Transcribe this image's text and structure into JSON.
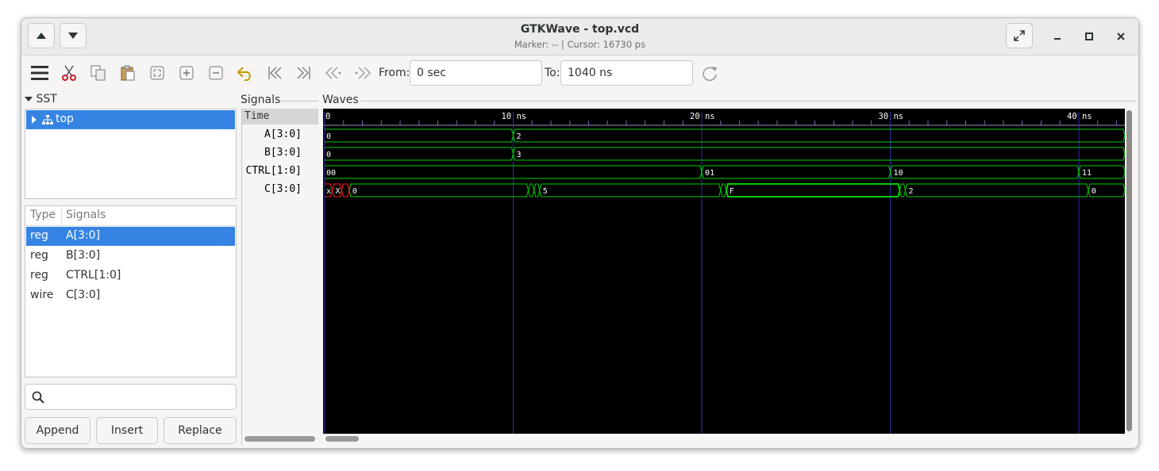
{
  "window": {
    "title": "GTKWave - top.vcd",
    "subtitle": "Marker: --  |  Cursor: 16730 ps"
  },
  "toolbar": {
    "icons": [
      "menu-icon",
      "cut-icon",
      "copy-icon",
      "paste-icon",
      "zoom-fit-icon",
      "zoom-in-icon",
      "zoom-out-icon",
      "undo-icon",
      "go-start-icon",
      "go-end-icon",
      "prev-edge-icon",
      "next-edge-icon",
      "reload-icon"
    ],
    "from_label": "From:",
    "from_value": "0 sec",
    "to_label": "To:",
    "to_value": "1040 ns"
  },
  "sst": {
    "header": "SST",
    "tree_item": "top"
  },
  "signal_list": {
    "col_type": "Type",
    "col_signals": "Signals",
    "rows": [
      {
        "type": "reg",
        "name": "A[3:0]"
      },
      {
        "type": "reg",
        "name": "B[3:0]"
      },
      {
        "type": "reg",
        "name": "CTRL[1:0]"
      },
      {
        "type": "wire",
        "name": "C[3:0]"
      }
    ],
    "search_placeholder": ""
  },
  "buttons": {
    "append": "Append",
    "insert": "Insert",
    "replace": "Replace"
  },
  "signals_pane": {
    "header": "Signals",
    "time_label": "Time",
    "names": [
      "A[3:0]",
      "B[3:0]",
      "CTRL[1:0]",
      "C[3:0]"
    ]
  },
  "waves_pane": {
    "header": "Waves",
    "ticks": [
      {
        "t": 0,
        "label": "0"
      },
      {
        "t": 10,
        "label": "10 ns"
      },
      {
        "t": 20,
        "label": "20 ns"
      },
      {
        "t": 30,
        "label": "30 ns"
      },
      {
        "t": 40,
        "label": "40 ns"
      }
    ],
    "view_end_ns": 42.5,
    "traces": [
      {
        "name": "A[3:0]",
        "segments": [
          {
            "t0": 0,
            "t1": 10,
            "v": "0"
          },
          {
            "t0": 10,
            "t1": 42.5,
            "v": "2"
          }
        ]
      },
      {
        "name": "B[3:0]",
        "segments": [
          {
            "t0": 0,
            "t1": 10,
            "v": "0"
          },
          {
            "t0": 10,
            "t1": 42.5,
            "v": "3"
          }
        ]
      },
      {
        "name": "CTRL[1:0]",
        "segments": [
          {
            "t0": 0,
            "t1": 20,
            "v": "00"
          },
          {
            "t0": 20,
            "t1": 30,
            "v": "01"
          },
          {
            "t0": 30,
            "t1": 40,
            "v": "10"
          },
          {
            "t0": 40,
            "t1": 42.5,
            "v": "11"
          }
        ]
      },
      {
        "name": "C[3:0]",
        "segments": [
          {
            "t0": 0,
            "t1": 0.4,
            "v": "x",
            "x": true
          },
          {
            "t0": 0.4,
            "t1": 0.9,
            "v": "X",
            "x": true
          },
          {
            "t0": 0.9,
            "t1": 1.3,
            "v": "",
            "x": true
          },
          {
            "t0": 1.3,
            "t1": 10.8,
            "v": "0"
          },
          {
            "t0": 10.8,
            "t1": 11.1,
            "v": ""
          },
          {
            "t0": 11.1,
            "t1": 11.4,
            "v": ""
          },
          {
            "t0": 11.4,
            "t1": 21.0,
            "v": "5"
          },
          {
            "t0": 21.0,
            "t1": 21.3,
            "v": ""
          },
          {
            "t0": 21.3,
            "t1": 30.5,
            "v": "F",
            "bold": true
          },
          {
            "t0": 30.5,
            "t1": 30.8,
            "v": ""
          },
          {
            "t0": 30.8,
            "t1": 40.5,
            "v": "2"
          },
          {
            "t0": 40.5,
            "t1": 42.5,
            "v": "0"
          }
        ]
      }
    ]
  },
  "colors": {
    "wave_bg": "#000000",
    "trace": "#00d000",
    "unknown": "#ff2020",
    "grid": "#3030a0",
    "selection": "#3584e4"
  }
}
